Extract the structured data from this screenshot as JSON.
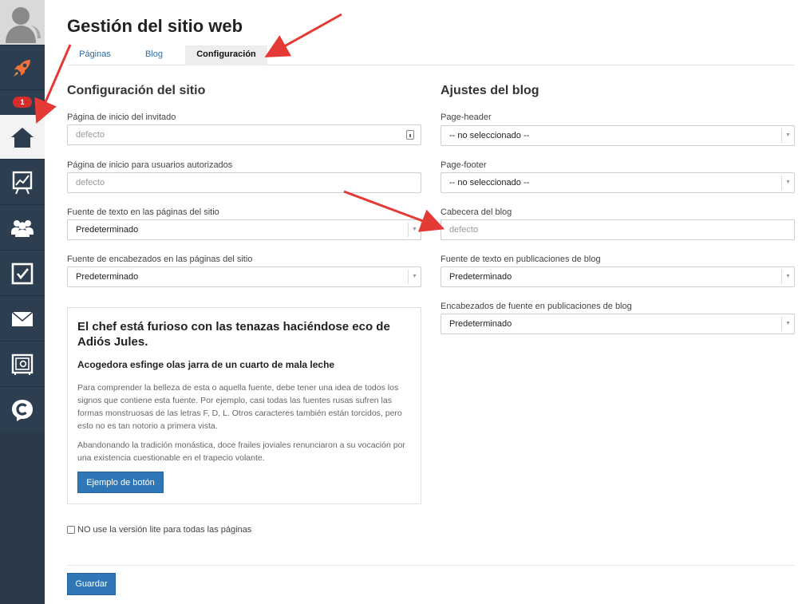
{
  "sidebar": {
    "badge": "1",
    "items": [
      {
        "name": "user-avatar",
        "icon": "user-silhouette-icon"
      },
      {
        "name": "launch",
        "icon": "rocket-icon"
      },
      {
        "name": "home",
        "icon": "home-icon",
        "active": true
      },
      {
        "name": "statistics",
        "icon": "chart-board-icon"
      },
      {
        "name": "users",
        "icon": "users-group-icon"
      },
      {
        "name": "tasks",
        "icon": "checkbox-icon"
      },
      {
        "name": "mail",
        "icon": "envelope-icon"
      },
      {
        "name": "safe",
        "icon": "safe-icon"
      },
      {
        "name": "chat",
        "icon": "chat-c-icon"
      }
    ]
  },
  "page": {
    "title": "Gestión del sitio web"
  },
  "tabs": [
    {
      "label": "Páginas"
    },
    {
      "label": "Blog"
    },
    {
      "label": "Configuración",
      "active": true
    }
  ],
  "site_settings": {
    "title": "Configuración del sitio",
    "guest_home_label": "Página de inicio del invitado",
    "guest_home_placeholder": "defecto",
    "auth_home_label": "Página de inicio para usuarios autorizados",
    "auth_home_placeholder": "defecto",
    "text_font_label": "Fuente de texto en las páginas del sitio",
    "text_font_value": "Predeterminado",
    "heading_font_label": "Fuente de encabezados en las páginas del sitio",
    "heading_font_value": "Predeterminado"
  },
  "preview": {
    "heading1": "El chef está furioso con las tenazas haciéndose eco de Adiós Jules.",
    "heading2": "Acogedora esfinge olas jarra de un cuarto de mala leche",
    "paragraph1": "Para comprender la belleza de esta o aquella fuente, debe tener una idea de todos los signos que contiene esta fuente. Por ejemplo, casi todas las fuentes rusas sufren las formas monstruosas de las letras F, D, L. Otros caracteres también están torcidos, pero esto no es tan notorio a primera vista.",
    "paragraph2": "Abandonando la tradición monástica, doce frailes joviales renunciaron a su vocación por una existencia cuestionable en el trapecio volante.",
    "button_label": "Ejemplo de botón"
  },
  "blog_settings": {
    "title": "Ajustes del blog",
    "page_header_label": "Page-header",
    "page_header_value": "-- no seleccionado --",
    "page_footer_label": "Page-footer",
    "page_footer_value": "-- no seleccionado --",
    "blog_header_label": "Cabecera del blog",
    "blog_header_placeholder": "defecto",
    "post_text_font_label": "Fuente de texto en publicaciones de blog",
    "post_text_font_value": "Predeterminado",
    "post_heading_font_label": "Encabezados de fuente en publicaciones de blog",
    "post_heading_font_value": "Predeterminado"
  },
  "lite_checkbox": {
    "label": "NO use la versión lite para todas las páginas",
    "checked": false
  },
  "save_button": {
    "label": "Guardar"
  },
  "colors": {
    "sidebar_bg": "#2c3e50",
    "accent_blue": "#2f77b6",
    "badge_red": "#d62c2c",
    "annotation_arrow": "#e53935"
  }
}
